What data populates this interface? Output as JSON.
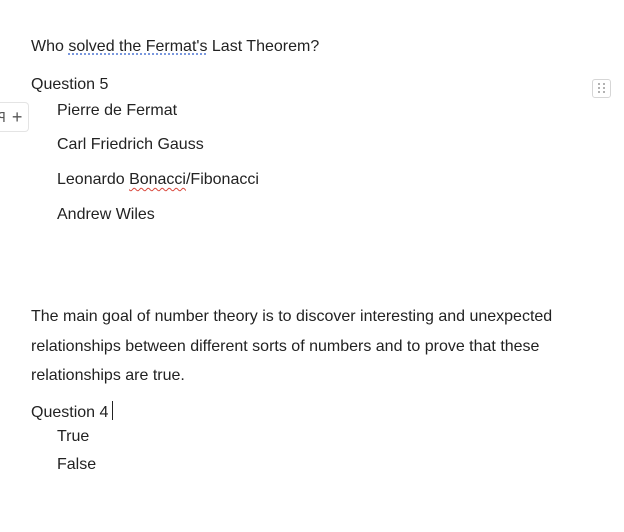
{
  "question_5": {
    "prompt_before": "Who ",
    "prompt_flag1": "solved the Fermat's",
    "prompt_after": " Last Theorem?",
    "label": "Question 5",
    "options": {
      "o1": "Pierre de Fermat",
      "o2": "Carl Friedrich Gauss",
      "o3_before": "Leonardo ",
      "o3_flag": "Bonacci",
      "o3_after": "/Fibonacci",
      "o4": "Andrew Wiles"
    }
  },
  "paragraph": {
    "text": "The main goal of number theory is to discover interesting and unexpected relationships between different sorts of numbers and to prove that these relationships are true."
  },
  "question_4": {
    "label": "Question 4",
    "options": {
      "t1": "True",
      "t2": "False"
    }
  },
  "controls": {
    "plus_glyph": "+",
    "marker_glyph": "ꟼ",
    "handle_icon": "drag-grid-icon"
  },
  "colors": {
    "text": "#222222",
    "spell_wavy": "#d8453a",
    "spell_dotted": "#5a7fd6",
    "handle_border": "#d6d6d6"
  }
}
